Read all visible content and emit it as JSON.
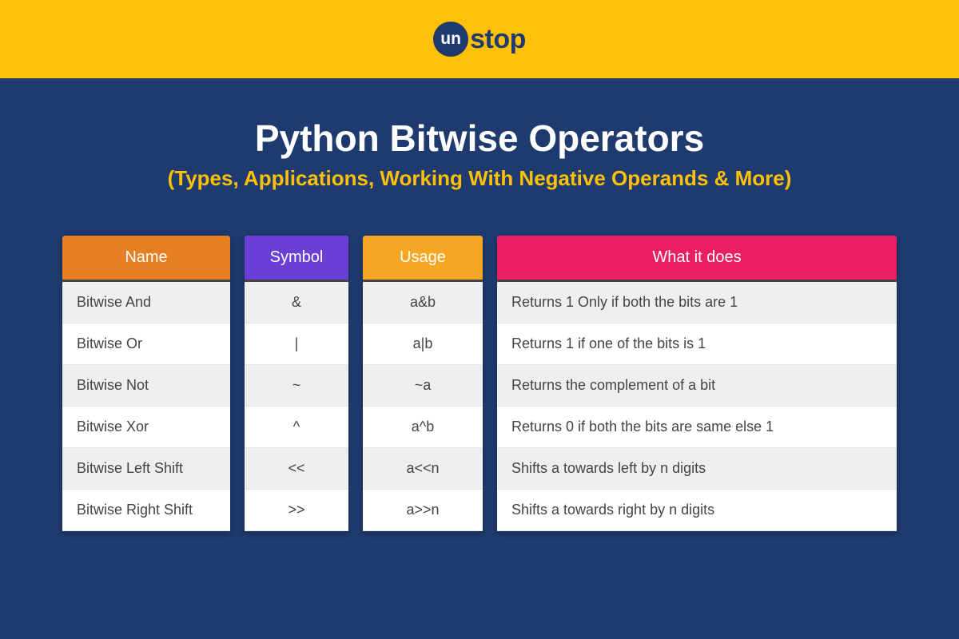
{
  "logo": {
    "circle_text": "un",
    "rest_text": "stop"
  },
  "title": "Python Bitwise Operators",
  "subtitle": "(Types, Applications, Working With Negative Operands & More)",
  "columns": {
    "name": {
      "header": "Name",
      "rows": [
        "Bitwise And",
        "Bitwise Or",
        "Bitwise Not",
        "Bitwise Xor",
        "Bitwise Left Shift",
        "Bitwise Right Shift"
      ]
    },
    "symbol": {
      "header": "Symbol",
      "rows": [
        "&",
        "|",
        "~",
        "^",
        "<<",
        ">>"
      ]
    },
    "usage": {
      "header": "Usage",
      "rows": [
        "a&b",
        "a|b",
        "~a",
        "a^b",
        "a<<n",
        "a>>n"
      ]
    },
    "desc": {
      "header": "What it does",
      "rows": [
        "Returns 1 Only if both the bits are 1",
        "Returns 1 if one of the bits is 1",
        "Returns the complement of a bit",
        "Returns 0 if both the bits are same else 1",
        "Shifts a towards left by n digits",
        "Shifts a towards right by n digits"
      ]
    }
  }
}
